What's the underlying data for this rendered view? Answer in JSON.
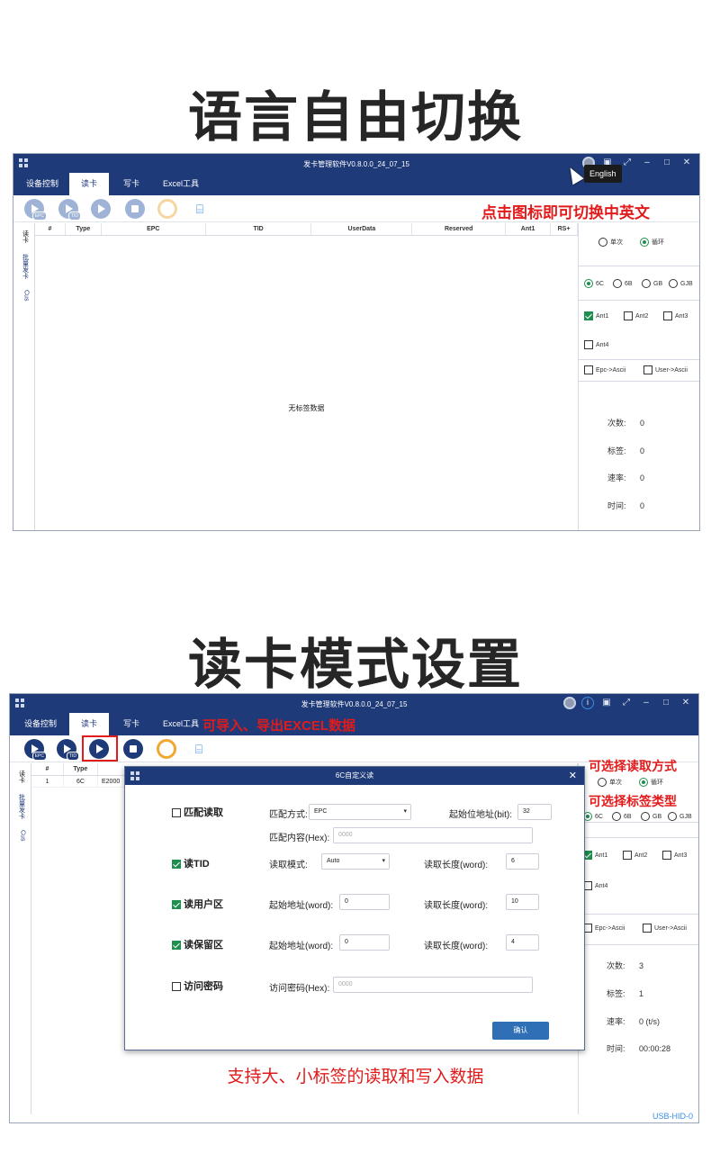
{
  "section1": {
    "heading": "语言自由切换",
    "window_title": "发卡管理软件V0.8.0.0_24_07_15",
    "tabs": [
      "设备控制",
      "读卡",
      "写卡",
      "Excel工具"
    ],
    "toolbar_labels": {
      "epc": "EPC",
      "tid": "TID"
    },
    "columns": [
      "#",
      "Type",
      "EPC",
      "TID",
      "UserData",
      "Reserved",
      "Ant1",
      "RS+"
    ],
    "side_tabs": [
      "读卡",
      "批量发卡",
      "Cus"
    ],
    "empty_text": "无标签数据",
    "annotation": "点击图标即可切换中英文",
    "tooltip": "English",
    "mode": {
      "single": "单次",
      "loop": "循环"
    },
    "protocols": [
      "6C",
      "6B",
      "GB",
      "GJB"
    ],
    "ants": [
      "Ant1",
      "Ant2",
      "Ant3",
      "Ant4"
    ],
    "conv": [
      "Epc->Ascii",
      "User->Ascii"
    ],
    "stats": [
      {
        "label": "次数:",
        "value": "0"
      },
      {
        "label": "标签:",
        "value": "0"
      },
      {
        "label": "速率:",
        "value": "0"
      },
      {
        "label": "时间:",
        "value": "0"
      }
    ]
  },
  "section2": {
    "heading": "读卡模式设置",
    "window_title": "发卡管理软件V0.8.0.0_24_07_15",
    "tabs": [
      "设备控制",
      "读卡",
      "写卡",
      "Excel工具"
    ],
    "toolbar_labels": {
      "epc": "EPC",
      "tid": "TID"
    },
    "columns": [
      "#",
      "Type"
    ],
    "row": {
      "num": "1",
      "type": "6C",
      "epc": "E2000"
    },
    "side_tabs": [
      "读卡",
      "批量发卡",
      "Cus"
    ],
    "annotations": {
      "excel": "可导入、导出EXCEL数据",
      "read_mode": "可选择读取方式",
      "tag_type": "可选择标签类型",
      "bottom": "支持大、小标签的读取和写入数据"
    },
    "mode": {
      "single": "单次",
      "loop": "循环"
    },
    "protocols": [
      "6C",
      "6B",
      "GB",
      "GJB"
    ],
    "ants": [
      "Ant1",
      "Ant2",
      "Ant3",
      "Ant4"
    ],
    "conv": [
      "Epc->Ascii",
      "User->Ascii"
    ],
    "stats": [
      {
        "label": "次数:",
        "value": "3"
      },
      {
        "label": "标签:",
        "value": "1"
      },
      {
        "label": "速率:",
        "value": "0 (t/s)"
      },
      {
        "label": "时间:",
        "value": "00:00:28"
      }
    ],
    "status": "USB-HID-0",
    "dialog": {
      "title": "6C自定义读",
      "match_read": "匹配读取",
      "match_mode_label": "匹配方式:",
      "match_mode_value": "EPC",
      "start_bit_label": "起始位地址(bit):",
      "start_bit_value": "32",
      "match_content_label": "匹配内容(Hex):",
      "match_content_placeholder": "0000",
      "read_tid": "读TID",
      "read_mode_label": "读取模式:",
      "read_mode_value": "Auto",
      "tid_len_label": "读取长度(word):",
      "tid_len_value": "6",
      "read_user": "读用户区",
      "user_start_label": "起始地址(word):",
      "user_start_value": "0",
      "user_len_label": "读取长度(word):",
      "user_len_value": "10",
      "read_reserved": "读保留区",
      "res_start_label": "起始地址(word):",
      "res_start_value": "0",
      "res_len_label": "读取长度(word):",
      "res_len_value": "4",
      "access_pwd": "访问密码",
      "access_pwd_label": "访问密码(Hex):",
      "access_pwd_placeholder": "0000",
      "ok": "确认"
    }
  }
}
